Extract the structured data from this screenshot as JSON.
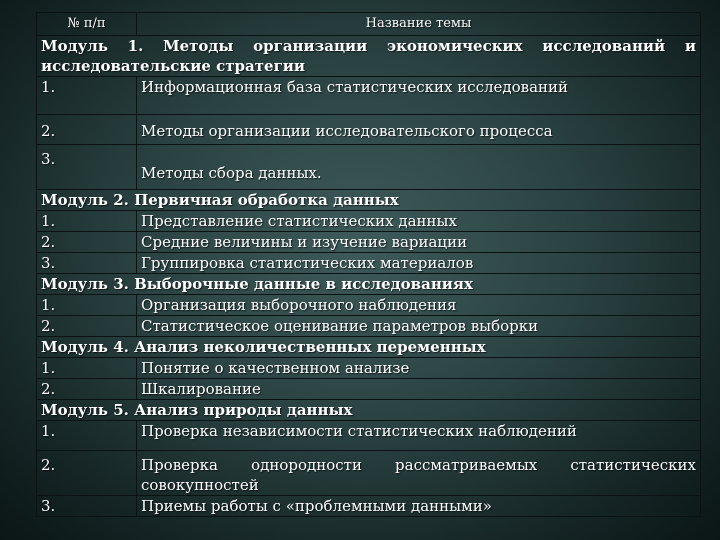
{
  "header": {
    "num": "№ п/п",
    "title": "Название темы"
  },
  "modules": [
    {
      "title_words": [
        "Модуль",
        "1.",
        "Методы",
        "организации",
        "экономических",
        "исследований",
        "и"
      ],
      "title_line2": "исследовательские стратегии",
      "topics": [
        {
          "num": "1.",
          "title": "Информационная база статистических исследований"
        },
        {
          "num": "2.",
          "title": "Методы организации исследовательского процесса"
        },
        {
          "num": "3.",
          "title": "Методы сбора данных."
        }
      ]
    },
    {
      "title": "Модуль 2. Первичная обработка данных",
      "topics": [
        {
          "num": "1.",
          "title": "Представление статистических данных"
        },
        {
          "num": "2.",
          "title": "Средние величины и изучение вариации"
        },
        {
          "num": "3.",
          "title": "Группировка статистических материалов"
        }
      ]
    },
    {
      "title": "Модуль 3. Выборочные данные в исследованиях",
      "topics": [
        {
          "num": "1.",
          "title": "Организация выборочного наблюдения"
        },
        {
          "num": "2.",
          "title": "Статистическое оценивание параметров выборки"
        }
      ]
    },
    {
      "title": "Модуль 4. Анализ неколичественных переменных",
      "topics": [
        {
          "num": "1.",
          "title": "Понятие о качественном анализе"
        },
        {
          "num": "2.",
          "title": "Шкалирование"
        }
      ]
    },
    {
      "title": "Модуль 5. Анализ природы данных",
      "topics": [
        {
          "num": "1.",
          "title": "Проверка независимости статистических наблюдений"
        },
        {
          "num": "2.",
          "title_words": [
            "Проверка",
            "однородности",
            "рассматриваемых",
            "статистических"
          ],
          "title_line2": "совокупностей"
        },
        {
          "num": "3.",
          "title": "Приемы работы с «проблемными данными»"
        }
      ]
    }
  ]
}
